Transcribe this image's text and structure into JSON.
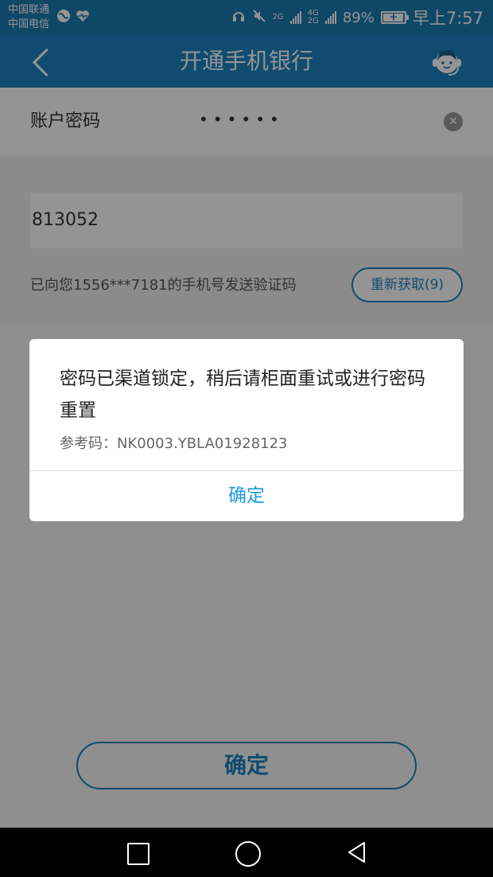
{
  "status_bar": {
    "carrier1": "中国联通",
    "carrier2": "中国电信",
    "net1": "2G",
    "net2_top": "4G",
    "net2_bottom": "2G",
    "battery": "89%",
    "battery_level": 0.89,
    "time": "早上7:57"
  },
  "navbar": {
    "title": "开通手机银行"
  },
  "form": {
    "password_label": "账户密码",
    "password_value": "••••••",
    "code_value": "813052",
    "sms_tip": "已向您1556***7181的手机号发送验证码",
    "resend_label": "重新获取(9)",
    "confirm_label": "确定"
  },
  "dialog": {
    "message": "密码已渠道锁定，稍后请柜面重试或进行密码重置",
    "ref_code": "参考码：NK0003.YBLA01928123",
    "ok_label": "确定"
  },
  "colors": {
    "brand": "#1a84bf",
    "link": "#1a9ae0"
  }
}
